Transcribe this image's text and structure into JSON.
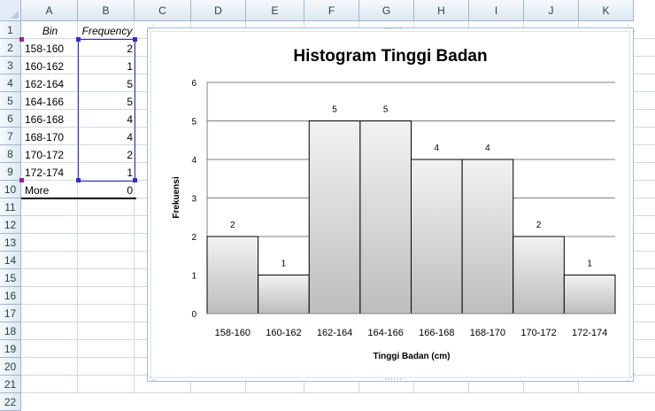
{
  "columns": [
    "A",
    "B",
    "C",
    "D",
    "E",
    "F",
    "G",
    "H",
    "I",
    "J",
    "K"
  ],
  "rows": [
    "1",
    "2",
    "3",
    "4",
    "5",
    "6",
    "7",
    "8",
    "9",
    "10",
    "11",
    "12",
    "13",
    "14",
    "15",
    "16",
    "17",
    "18",
    "19",
    "20",
    "21",
    "22"
  ],
  "table": {
    "header_bin": "Bin",
    "header_frequency": "Frequency",
    "bins": [
      "158-160",
      "160-162",
      "162-164",
      "164-166",
      "166-168",
      "168-170",
      "170-172",
      "172-174",
      "More"
    ],
    "frequencies": [
      "2",
      "1",
      "5",
      "5",
      "4",
      "4",
      "2",
      "1",
      "0"
    ]
  },
  "chart_data": {
    "type": "bar",
    "title": "Histogram Tinggi Badan",
    "xlabel": "Tinggi Badan  (cm)",
    "ylabel": "Frekuensi",
    "categories": [
      "158-160",
      "160-162",
      "162-164",
      "164-166",
      "166-168",
      "168-170",
      "170-172",
      "172-174"
    ],
    "values": [
      2,
      1,
      5,
      5,
      4,
      4,
      2,
      1
    ],
    "data_labels": [
      "2",
      "1",
      "5",
      "5",
      "4",
      "4",
      "2",
      "1"
    ],
    "y_ticks": [
      "0",
      "1",
      "2",
      "3",
      "4",
      "5",
      "6"
    ],
    "ylim": [
      0,
      6
    ],
    "grid": true,
    "legend": "none",
    "bar_color": "#e6e6e6"
  }
}
